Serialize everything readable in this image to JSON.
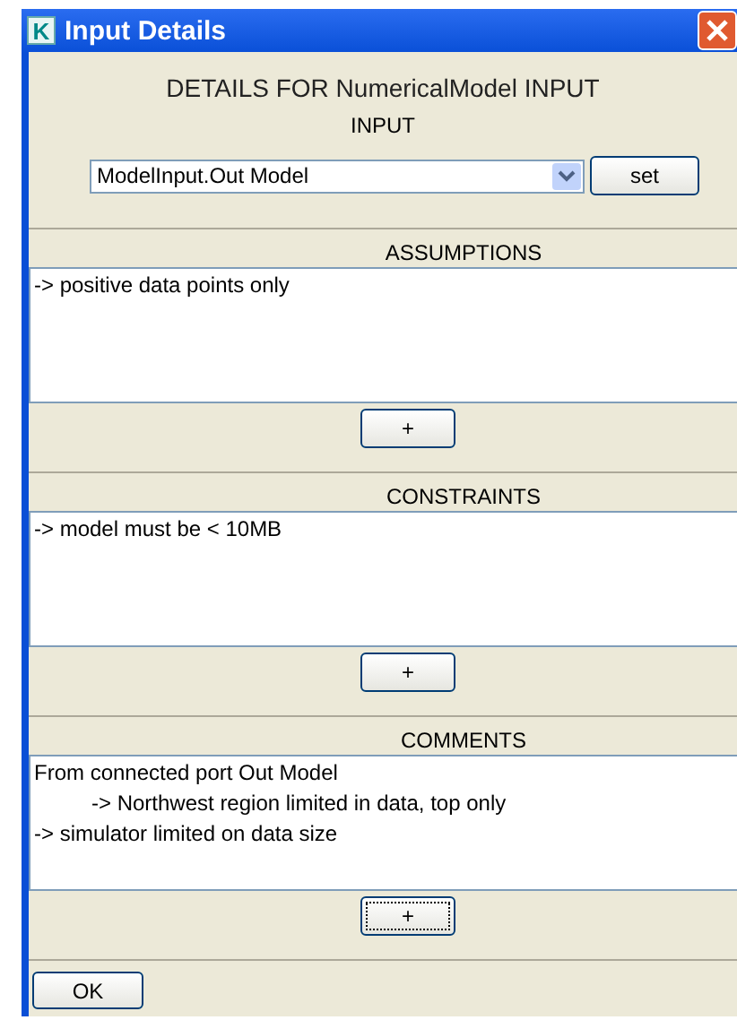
{
  "window": {
    "title": "Input Details",
    "app_letter": "K"
  },
  "heading": "DETAILS FOR NumericalModel INPUT",
  "input": {
    "label": "INPUT",
    "value": "ModelInput.Out Model",
    "button": "set"
  },
  "sections": [
    {
      "title": "ASSUMPTIONS",
      "lines": [
        {
          "text": "-> positive data points only"
        }
      ],
      "add_button": {
        "label": "+",
        "focused": false
      }
    },
    {
      "title": "CONSTRAINTS",
      "lines": [
        {
          "text": "-> model must be < 10MB"
        }
      ],
      "add_button": {
        "label": "+",
        "focused": false
      }
    },
    {
      "title": "COMMENTS",
      "lines": [
        {
          "text": "From connected port Out Model",
          "children": [
            {
              "text": "-> Northwest region limited in data, top only"
            }
          ]
        },
        {
          "text": "-> simulator limited on data size"
        }
      ],
      "add_button": {
        "label": "+",
        "focused": true
      }
    }
  ],
  "ok_button": "OK"
}
